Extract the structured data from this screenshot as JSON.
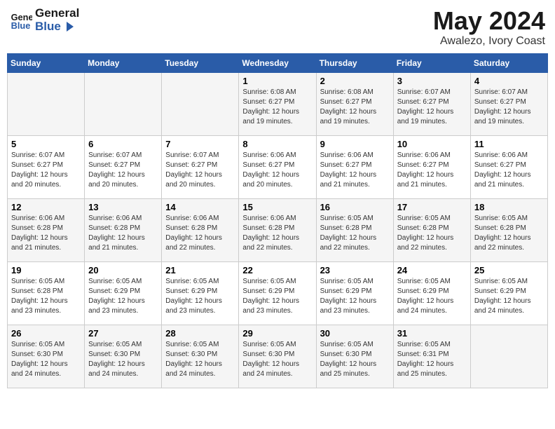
{
  "header": {
    "logo_line1": "General",
    "logo_line2": "Blue",
    "month": "May 2024",
    "location": "Awalezo, Ivory Coast"
  },
  "weekdays": [
    "Sunday",
    "Monday",
    "Tuesday",
    "Wednesday",
    "Thursday",
    "Friday",
    "Saturday"
  ],
  "weeks": [
    [
      {
        "day": "",
        "sunrise": "",
        "sunset": "",
        "daylight": ""
      },
      {
        "day": "",
        "sunrise": "",
        "sunset": "",
        "daylight": ""
      },
      {
        "day": "",
        "sunrise": "",
        "sunset": "",
        "daylight": ""
      },
      {
        "day": "1",
        "sunrise": "Sunrise: 6:08 AM",
        "sunset": "Sunset: 6:27 PM",
        "daylight": "Daylight: 12 hours and 19 minutes."
      },
      {
        "day": "2",
        "sunrise": "Sunrise: 6:08 AM",
        "sunset": "Sunset: 6:27 PM",
        "daylight": "Daylight: 12 hours and 19 minutes."
      },
      {
        "day": "3",
        "sunrise": "Sunrise: 6:07 AM",
        "sunset": "Sunset: 6:27 PM",
        "daylight": "Daylight: 12 hours and 19 minutes."
      },
      {
        "day": "4",
        "sunrise": "Sunrise: 6:07 AM",
        "sunset": "Sunset: 6:27 PM",
        "daylight": "Daylight: 12 hours and 19 minutes."
      }
    ],
    [
      {
        "day": "5",
        "sunrise": "Sunrise: 6:07 AM",
        "sunset": "Sunset: 6:27 PM",
        "daylight": "Daylight: 12 hours and 20 minutes."
      },
      {
        "day": "6",
        "sunrise": "Sunrise: 6:07 AM",
        "sunset": "Sunset: 6:27 PM",
        "daylight": "Daylight: 12 hours and 20 minutes."
      },
      {
        "day": "7",
        "sunrise": "Sunrise: 6:07 AM",
        "sunset": "Sunset: 6:27 PM",
        "daylight": "Daylight: 12 hours and 20 minutes."
      },
      {
        "day": "8",
        "sunrise": "Sunrise: 6:06 AM",
        "sunset": "Sunset: 6:27 PM",
        "daylight": "Daylight: 12 hours and 20 minutes."
      },
      {
        "day": "9",
        "sunrise": "Sunrise: 6:06 AM",
        "sunset": "Sunset: 6:27 PM",
        "daylight": "Daylight: 12 hours and 21 minutes."
      },
      {
        "day": "10",
        "sunrise": "Sunrise: 6:06 AM",
        "sunset": "Sunset: 6:27 PM",
        "daylight": "Daylight: 12 hours and 21 minutes."
      },
      {
        "day": "11",
        "sunrise": "Sunrise: 6:06 AM",
        "sunset": "Sunset: 6:27 PM",
        "daylight": "Daylight: 12 hours and 21 minutes."
      }
    ],
    [
      {
        "day": "12",
        "sunrise": "Sunrise: 6:06 AM",
        "sunset": "Sunset: 6:28 PM",
        "daylight": "Daylight: 12 hours and 21 minutes."
      },
      {
        "day": "13",
        "sunrise": "Sunrise: 6:06 AM",
        "sunset": "Sunset: 6:28 PM",
        "daylight": "Daylight: 12 hours and 21 minutes."
      },
      {
        "day": "14",
        "sunrise": "Sunrise: 6:06 AM",
        "sunset": "Sunset: 6:28 PM",
        "daylight": "Daylight: 12 hours and 22 minutes."
      },
      {
        "day": "15",
        "sunrise": "Sunrise: 6:06 AM",
        "sunset": "Sunset: 6:28 PM",
        "daylight": "Daylight: 12 hours and 22 minutes."
      },
      {
        "day": "16",
        "sunrise": "Sunrise: 6:05 AM",
        "sunset": "Sunset: 6:28 PM",
        "daylight": "Daylight: 12 hours and 22 minutes."
      },
      {
        "day": "17",
        "sunrise": "Sunrise: 6:05 AM",
        "sunset": "Sunset: 6:28 PM",
        "daylight": "Daylight: 12 hours and 22 minutes."
      },
      {
        "day": "18",
        "sunrise": "Sunrise: 6:05 AM",
        "sunset": "Sunset: 6:28 PM",
        "daylight": "Daylight: 12 hours and 22 minutes."
      }
    ],
    [
      {
        "day": "19",
        "sunrise": "Sunrise: 6:05 AM",
        "sunset": "Sunset: 6:28 PM",
        "daylight": "Daylight: 12 hours and 23 minutes."
      },
      {
        "day": "20",
        "sunrise": "Sunrise: 6:05 AM",
        "sunset": "Sunset: 6:29 PM",
        "daylight": "Daylight: 12 hours and 23 minutes."
      },
      {
        "day": "21",
        "sunrise": "Sunrise: 6:05 AM",
        "sunset": "Sunset: 6:29 PM",
        "daylight": "Daylight: 12 hours and 23 minutes."
      },
      {
        "day": "22",
        "sunrise": "Sunrise: 6:05 AM",
        "sunset": "Sunset: 6:29 PM",
        "daylight": "Daylight: 12 hours and 23 minutes."
      },
      {
        "day": "23",
        "sunrise": "Sunrise: 6:05 AM",
        "sunset": "Sunset: 6:29 PM",
        "daylight": "Daylight: 12 hours and 23 minutes."
      },
      {
        "day": "24",
        "sunrise": "Sunrise: 6:05 AM",
        "sunset": "Sunset: 6:29 PM",
        "daylight": "Daylight: 12 hours and 24 minutes."
      },
      {
        "day": "25",
        "sunrise": "Sunrise: 6:05 AM",
        "sunset": "Sunset: 6:29 PM",
        "daylight": "Daylight: 12 hours and 24 minutes."
      }
    ],
    [
      {
        "day": "26",
        "sunrise": "Sunrise: 6:05 AM",
        "sunset": "Sunset: 6:30 PM",
        "daylight": "Daylight: 12 hours and 24 minutes."
      },
      {
        "day": "27",
        "sunrise": "Sunrise: 6:05 AM",
        "sunset": "Sunset: 6:30 PM",
        "daylight": "Daylight: 12 hours and 24 minutes."
      },
      {
        "day": "28",
        "sunrise": "Sunrise: 6:05 AM",
        "sunset": "Sunset: 6:30 PM",
        "daylight": "Daylight: 12 hours and 24 minutes."
      },
      {
        "day": "29",
        "sunrise": "Sunrise: 6:05 AM",
        "sunset": "Sunset: 6:30 PM",
        "daylight": "Daylight: 12 hours and 24 minutes."
      },
      {
        "day": "30",
        "sunrise": "Sunrise: 6:05 AM",
        "sunset": "Sunset: 6:30 PM",
        "daylight": "Daylight: 12 hours and 25 minutes."
      },
      {
        "day": "31",
        "sunrise": "Sunrise: 6:05 AM",
        "sunset": "Sunset: 6:31 PM",
        "daylight": "Daylight: 12 hours and 25 minutes."
      },
      {
        "day": "",
        "sunrise": "",
        "sunset": "",
        "daylight": ""
      }
    ]
  ]
}
